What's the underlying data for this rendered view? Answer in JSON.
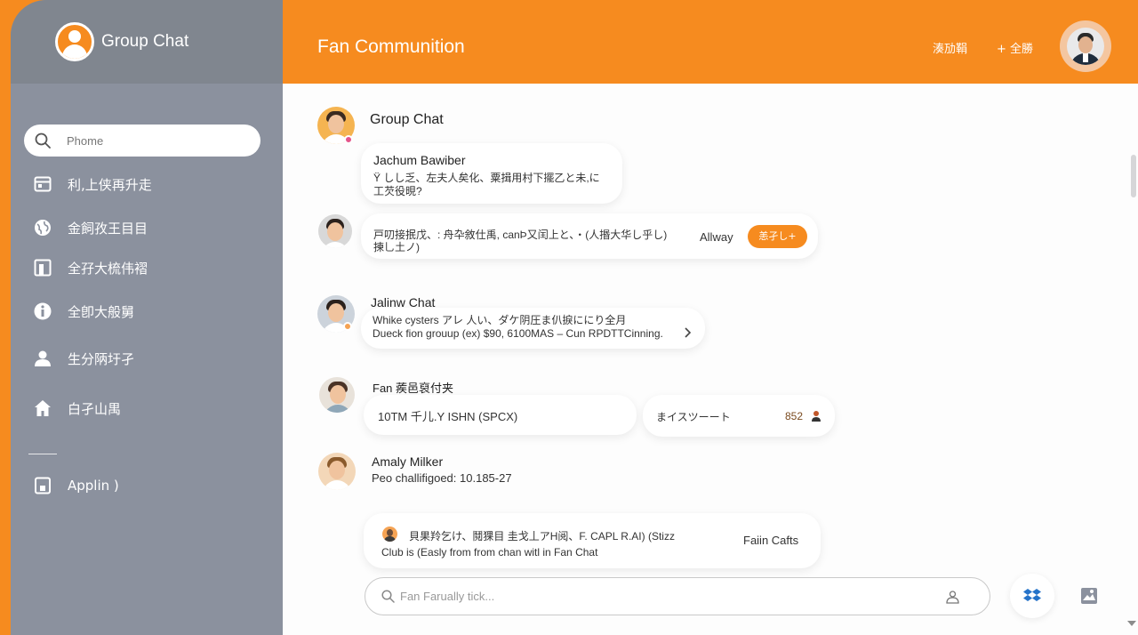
{
  "sidebar": {
    "title": "Group Chat",
    "search_placeholder": "Phome",
    "items": [
      {
        "label": "利,上侠再升走",
        "icon": "calendar-icon"
      },
      {
        "label": "金飼孜王目目",
        "icon": "globe-icon"
      },
      {
        "label": "全孖大梳伟褶",
        "icon": "book-icon"
      },
      {
        "label": "全卽大般舅",
        "icon": "info-icon"
      },
      {
        "label": "生分陃圩孑",
        "icon": "person-icon"
      },
      {
        "label": "白孑山禺",
        "icon": "home-icon"
      }
    ],
    "footer_item": {
      "label": "Applin )",
      "icon": "tablet-icon"
    }
  },
  "header": {
    "title": "Fan Communition",
    "link1": "湊劢鞙",
    "link2": "+ 全勝"
  },
  "chat": {
    "group_label": "Group Chat",
    "messages": [
      {
        "name": "Jachum Bawiber",
        "line1": "Ÿ しし乏、左夫人矣化、粟揖用村下擺乙と未,に",
        "line2": "工芡役晛?"
      },
      {
        "line1": "戸叨接抿戊、: 舟卆敘仕禹, canÞ又闰上と、・(人㨉大华し乎し)",
        "line2": "揀乚土ノ)",
        "side_text": "Allway",
        "action": "恙孑し+"
      },
      {
        "name": "Jalinw Chat",
        "line1": "Whike cysters  アレ 人い、ダケ阴圧ま仈捩ににり全月",
        "line2": "Dueck fion grouup (ex) $90, 6100MAS – Cun RPDTTCinning."
      },
      {
        "name": "Fan 蒺邑裒付夹",
        "line1": "10TM 千儿.Y ISHN (SPCX)",
        "side_text": "まイスツーート",
        "count": "852"
      },
      {
        "name": "Amaly Milker",
        "line1": "Peo challifigoed: 10.185-27"
      },
      {
        "line1": "貝果羚乞け、鬩猓目 圭戈丄アH阅、F.  CAPL R.AI) (Stizz",
        "line2": "Club is (Easly from from chan witl in Fan Chat",
        "side_text": "Faiin Cafts"
      }
    ]
  },
  "composer": {
    "placeholder": "Fan Farually tick..."
  },
  "colors": {
    "accent": "#f68b1f",
    "sidebar": "#8b919e",
    "sidebar_header": "#80868f",
    "canvas": "#fdfdfd"
  }
}
